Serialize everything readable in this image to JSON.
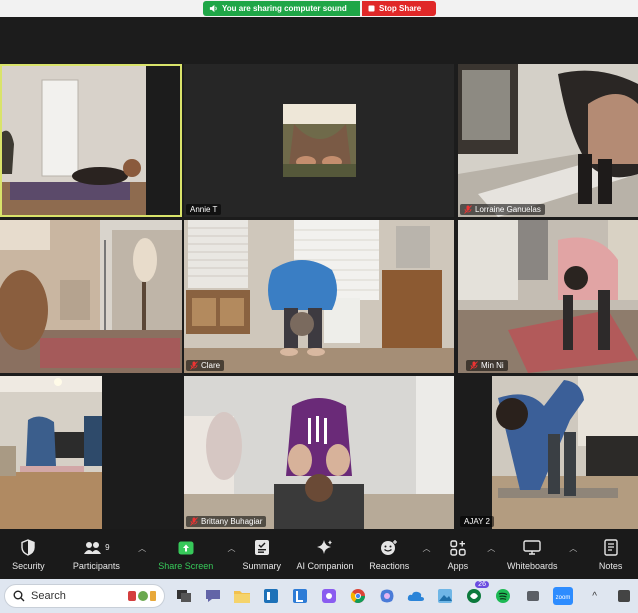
{
  "banner": {
    "sharing_text": "You are sharing computer sound",
    "stop_share_label": "Stop Share"
  },
  "participants": [
    {
      "name": "",
      "muted": false,
      "active": true
    },
    {
      "name": "Annie T",
      "muted": false,
      "active": false
    },
    {
      "name": "Lorraine Ganuelas",
      "muted": true,
      "active": false
    },
    {
      "name": "",
      "muted": false,
      "active": false
    },
    {
      "name": "Clare",
      "muted": true,
      "active": false
    },
    {
      "name": "Min Ni",
      "muted": true,
      "active": false
    },
    {
      "name": "",
      "muted": false,
      "active": false
    },
    {
      "name": "Brittany Buhagiar",
      "muted": true,
      "active": false
    },
    {
      "name": "AJAY 2",
      "muted": false,
      "active": false
    }
  ],
  "toolbar": {
    "security": "Security",
    "participants": "Participants",
    "participants_count": "9",
    "share_screen": "Share Screen",
    "summary": "Summary",
    "ai_companion": "AI Companion",
    "reactions": "Reactions",
    "apps": "Apps",
    "whiteboards": "Whiteboards",
    "notes": "Notes"
  },
  "taskbar": {
    "search_placeholder": "Search",
    "notification_badge": "26",
    "zoom_label": "zoom"
  },
  "colors": {
    "share_green": "#1fa647",
    "stop_red": "#e02828",
    "active_speaker": "#d9e36a",
    "share_screen_green": "#37c95a"
  }
}
